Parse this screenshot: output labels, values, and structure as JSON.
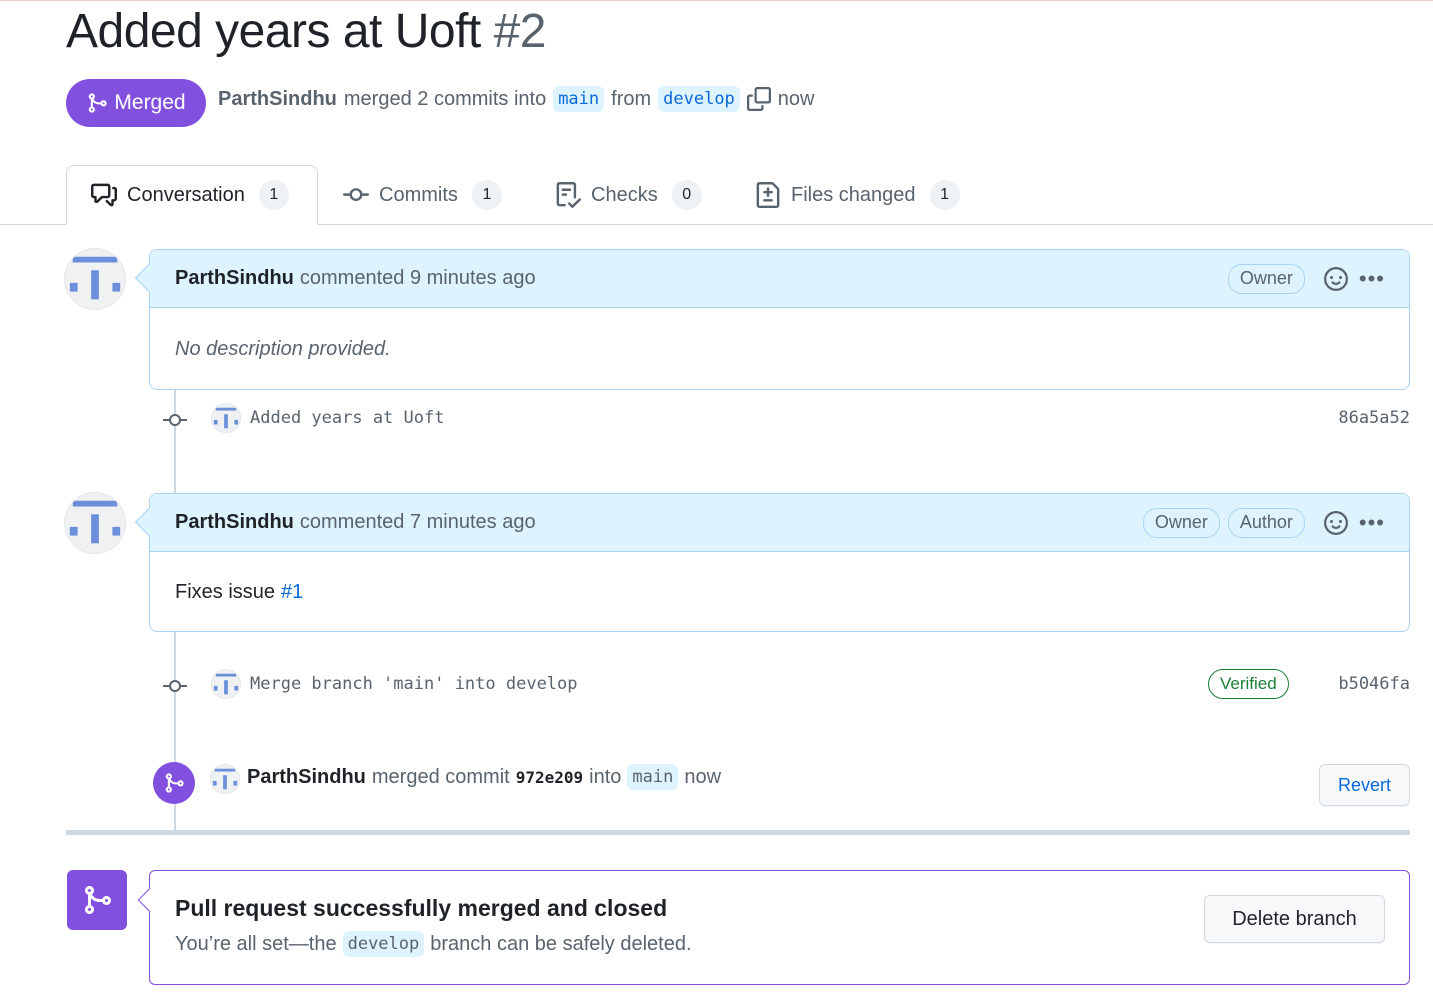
{
  "pr": {
    "title": "Added years at Uoft",
    "number": "#2",
    "state": "Merged",
    "author": "ParthSindhu",
    "summary_verb": "merged 2 commits into",
    "base_branch": "main",
    "from_word": "from",
    "head_branch": "develop",
    "time": "now"
  },
  "tabs": [
    {
      "label": "Conversation",
      "count": "1",
      "icon": "comment-discussion-icon"
    },
    {
      "label": "Commits",
      "count": "1",
      "icon": "git-commit-icon"
    },
    {
      "label": "Checks",
      "count": "0",
      "icon": "checklist-icon"
    },
    {
      "label": "Files changed",
      "count": "1",
      "icon": "file-diff-icon"
    }
  ],
  "comments": [
    {
      "author": "ParthSindhu",
      "meta": "commented 9 minutes ago",
      "roles": [
        "Owner"
      ],
      "body": "No description provided."
    },
    {
      "author": "ParthSindhu",
      "meta": "commented 7 minutes ago",
      "roles": [
        "Owner",
        "Author"
      ],
      "body": "Fixes issue",
      "link": "#1"
    }
  ],
  "commits": [
    {
      "message": "Added years at Uoft",
      "sha": "86a5a52"
    },
    {
      "message": "Merge branch 'main' into develop",
      "sha": "b5046fa",
      "badge": "Verified"
    }
  ],
  "merge_event": {
    "author": "ParthSindhu",
    "verb": "merged commit",
    "sha": "972e209",
    "into": "into",
    "branch": "main",
    "time": "now",
    "button": "Revert"
  },
  "merged_box": {
    "title": "Pull request successfully merged and closed",
    "sub_before": "You’re all set—the",
    "branch": "develop",
    "sub_after": "branch can be safely deleted.",
    "button": "Delete branch"
  },
  "colors": {
    "merged": "#8250df",
    "link": "#0969da",
    "verified": "#1a7f37",
    "comment_header": "#ddf4ff"
  }
}
